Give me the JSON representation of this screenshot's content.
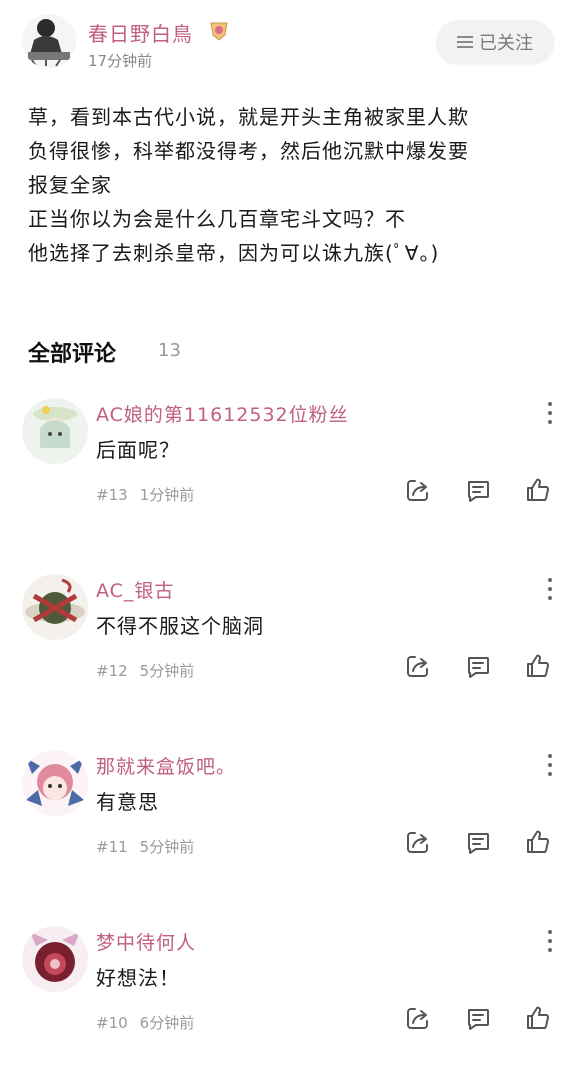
{
  "post": {
    "author": "春日野白鳥",
    "time": "17分钟前",
    "follow_label": "已关注",
    "body_lines": [
      "草，看到本古代小说，就是开头主角被家里人欺",
      "负得很惨，科举都没得考，然后他沉默中爆发要",
      "报复全家",
      "正当你以为会是什么几百章宅斗文吗？不",
      "他选择了去刺杀皇帝，因为可以诛九族(ﾟ∀。)"
    ]
  },
  "comments_section": {
    "title": "全部评论",
    "count": "13"
  },
  "comments": [
    {
      "name": "AC娘的第11612532位粉丝",
      "text": "后面呢？",
      "floor": "#13",
      "time": "1分钟前"
    },
    {
      "name": "AC_银古",
      "text": "不得不服这个脑洞",
      "floor": "#12",
      "time": "5分钟前"
    },
    {
      "name": "那就来盒饭吧。",
      "text": "有意思",
      "floor": "#11",
      "time": "5分钟前"
    },
    {
      "name": "梦中待何人",
      "text": "好想法！",
      "floor": "#10",
      "time": "6分钟前"
    }
  ],
  "icons": {
    "follow": "menu-lines-icon",
    "more": "more-vertical-icon",
    "share": "share-icon",
    "reply": "comment-icon",
    "like": "thumbs-up-icon"
  },
  "colors": {
    "username": "#c0607c",
    "meta": "#9a9a9a"
  }
}
